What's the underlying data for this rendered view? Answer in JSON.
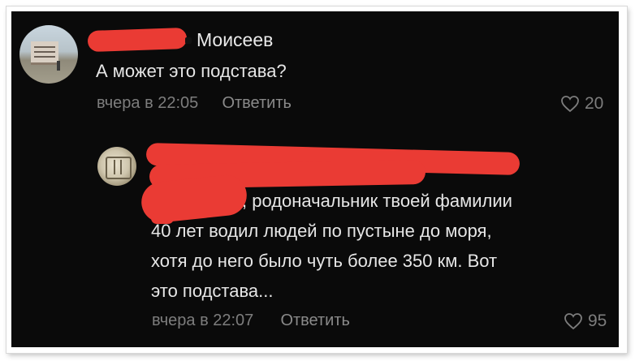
{
  "comments": [
    {
      "author_visible": "Моисеев",
      "text": "А может это подстава?",
      "time": "вчера в 22:05",
      "reply_label": "Ответить",
      "likes": "20"
    },
    {
      "lines": [
        ", родоначальник твоей фамилии",
        "40 лет водил людей по пустыне до моря,",
        "хотя до него было чуть более 350 км. Вот",
        "это подстава..."
      ],
      "time": "вчера в 22:07",
      "reply_label": "Ответить",
      "likes": "95"
    }
  ],
  "icons": {
    "like": "heart-outline-icon"
  },
  "colors": {
    "background": "#0a0a0a",
    "text": "#e6e6e6",
    "meta": "#7d7d7d",
    "redaction": "#ea3b34"
  }
}
